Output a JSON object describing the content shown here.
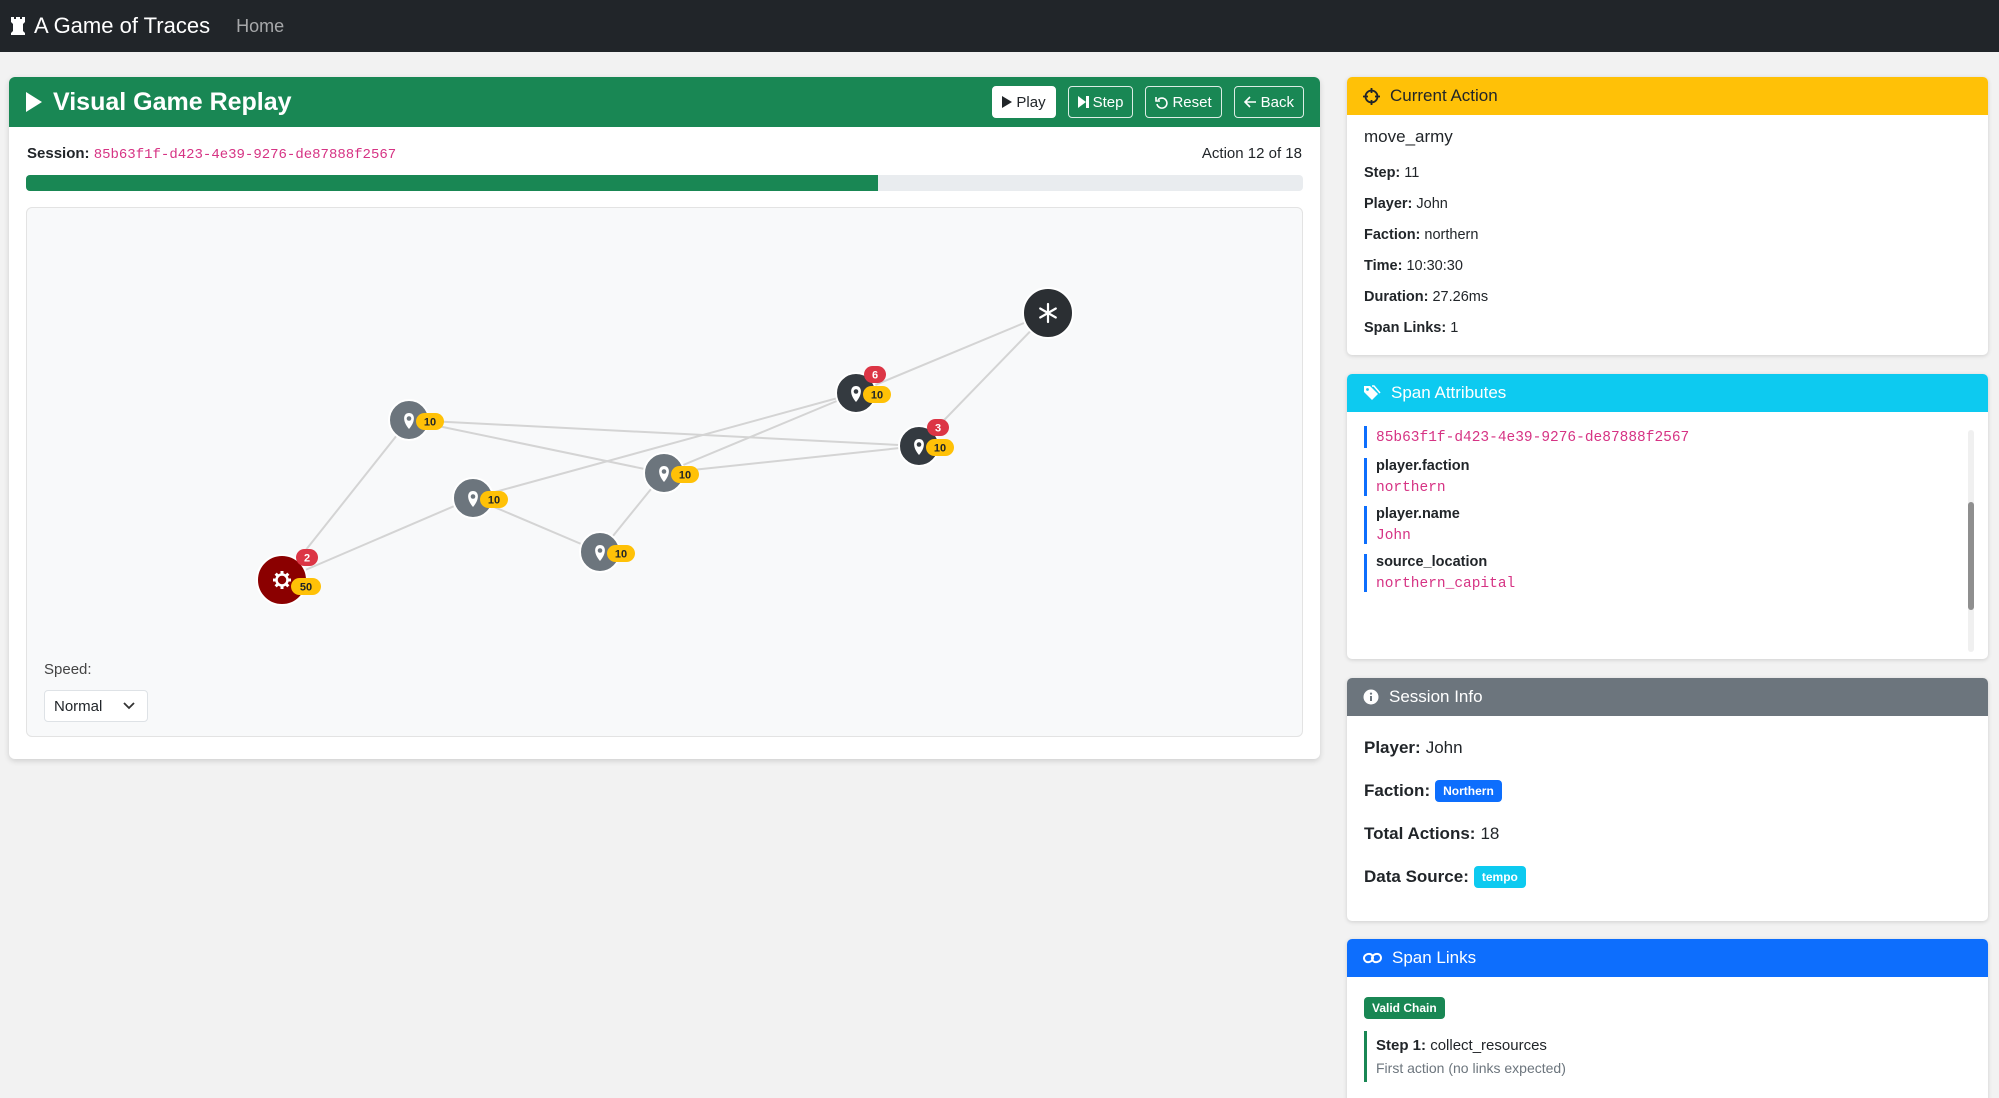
{
  "navbar": {
    "brand": "A Game of Traces",
    "home": "Home"
  },
  "replay": {
    "title": "Visual Game Replay",
    "buttons": {
      "play": "Play",
      "step": "Step",
      "reset": "Reset",
      "back": "Back"
    },
    "session_label": "Session:",
    "session_id": "85b63f1f-d423-4e39-9276-de87888f2567",
    "action_counter": "Action 12 of 18",
    "progress": 0.667,
    "speed_label": "Speed:",
    "speed_value": "Normal"
  },
  "map": {
    "nodes": [
      {
        "id": "capital-south",
        "kind": "capital",
        "army": "50",
        "enemy": "2",
        "color": "#8b0000"
      },
      {
        "id": "village-a",
        "kind": "village",
        "army": "10",
        "color": "#6c757d"
      },
      {
        "id": "village-b",
        "kind": "village",
        "army": "10",
        "color": "#6c757d"
      },
      {
        "id": "village-c",
        "kind": "village",
        "army": "10",
        "color": "#6c757d"
      },
      {
        "id": "village-d",
        "kind": "village",
        "army": "10",
        "color": "#6c757d"
      },
      {
        "id": "village-e",
        "kind": "village",
        "army": "10",
        "enemy": "6",
        "color": "#343a40"
      },
      {
        "id": "village-f",
        "kind": "village",
        "army": "10",
        "enemy": "3",
        "color": "#343a40"
      },
      {
        "id": "capital-north",
        "kind": "capital-north",
        "color": "#2b2f33"
      }
    ]
  },
  "current_action": {
    "header": "Current Action",
    "name": "move_army",
    "fields": [
      {
        "label": "Step:",
        "value": "11"
      },
      {
        "label": "Player:",
        "value": "John"
      },
      {
        "label": "Faction:",
        "value": "northern"
      },
      {
        "label": "Time:",
        "value": "10:30:30"
      },
      {
        "label": "Duration:",
        "value": "27.26ms"
      },
      {
        "label": "Span Links:",
        "value": "1"
      }
    ]
  },
  "span_attributes": {
    "header": "Span Attributes",
    "top_value": "85b63f1f-d423-4e39-9276-de87888f2567",
    "items": [
      {
        "key": "player.faction",
        "value": "northern"
      },
      {
        "key": "player.name",
        "value": "John"
      },
      {
        "key": "source_location",
        "value": "northern_capital"
      }
    ]
  },
  "session_info": {
    "header": "Session Info",
    "player_label": "Player:",
    "player": "John",
    "faction_label": "Faction:",
    "faction": "Northern",
    "total_label": "Total Actions:",
    "total": "18",
    "source_label": "Data Source:",
    "source": "tempo"
  },
  "span_links": {
    "header": "Span Links",
    "badge": "Valid Chain",
    "step_label": "Step 1:",
    "step_action": "collect_resources",
    "step_note": "First action (no links expected)"
  },
  "colors": {
    "success": "#198754",
    "warning": "#ffc107",
    "info": "#0dcaf0",
    "secondary": "#6c757d",
    "primary": "#0d6efd",
    "danger": "#dc3545"
  }
}
